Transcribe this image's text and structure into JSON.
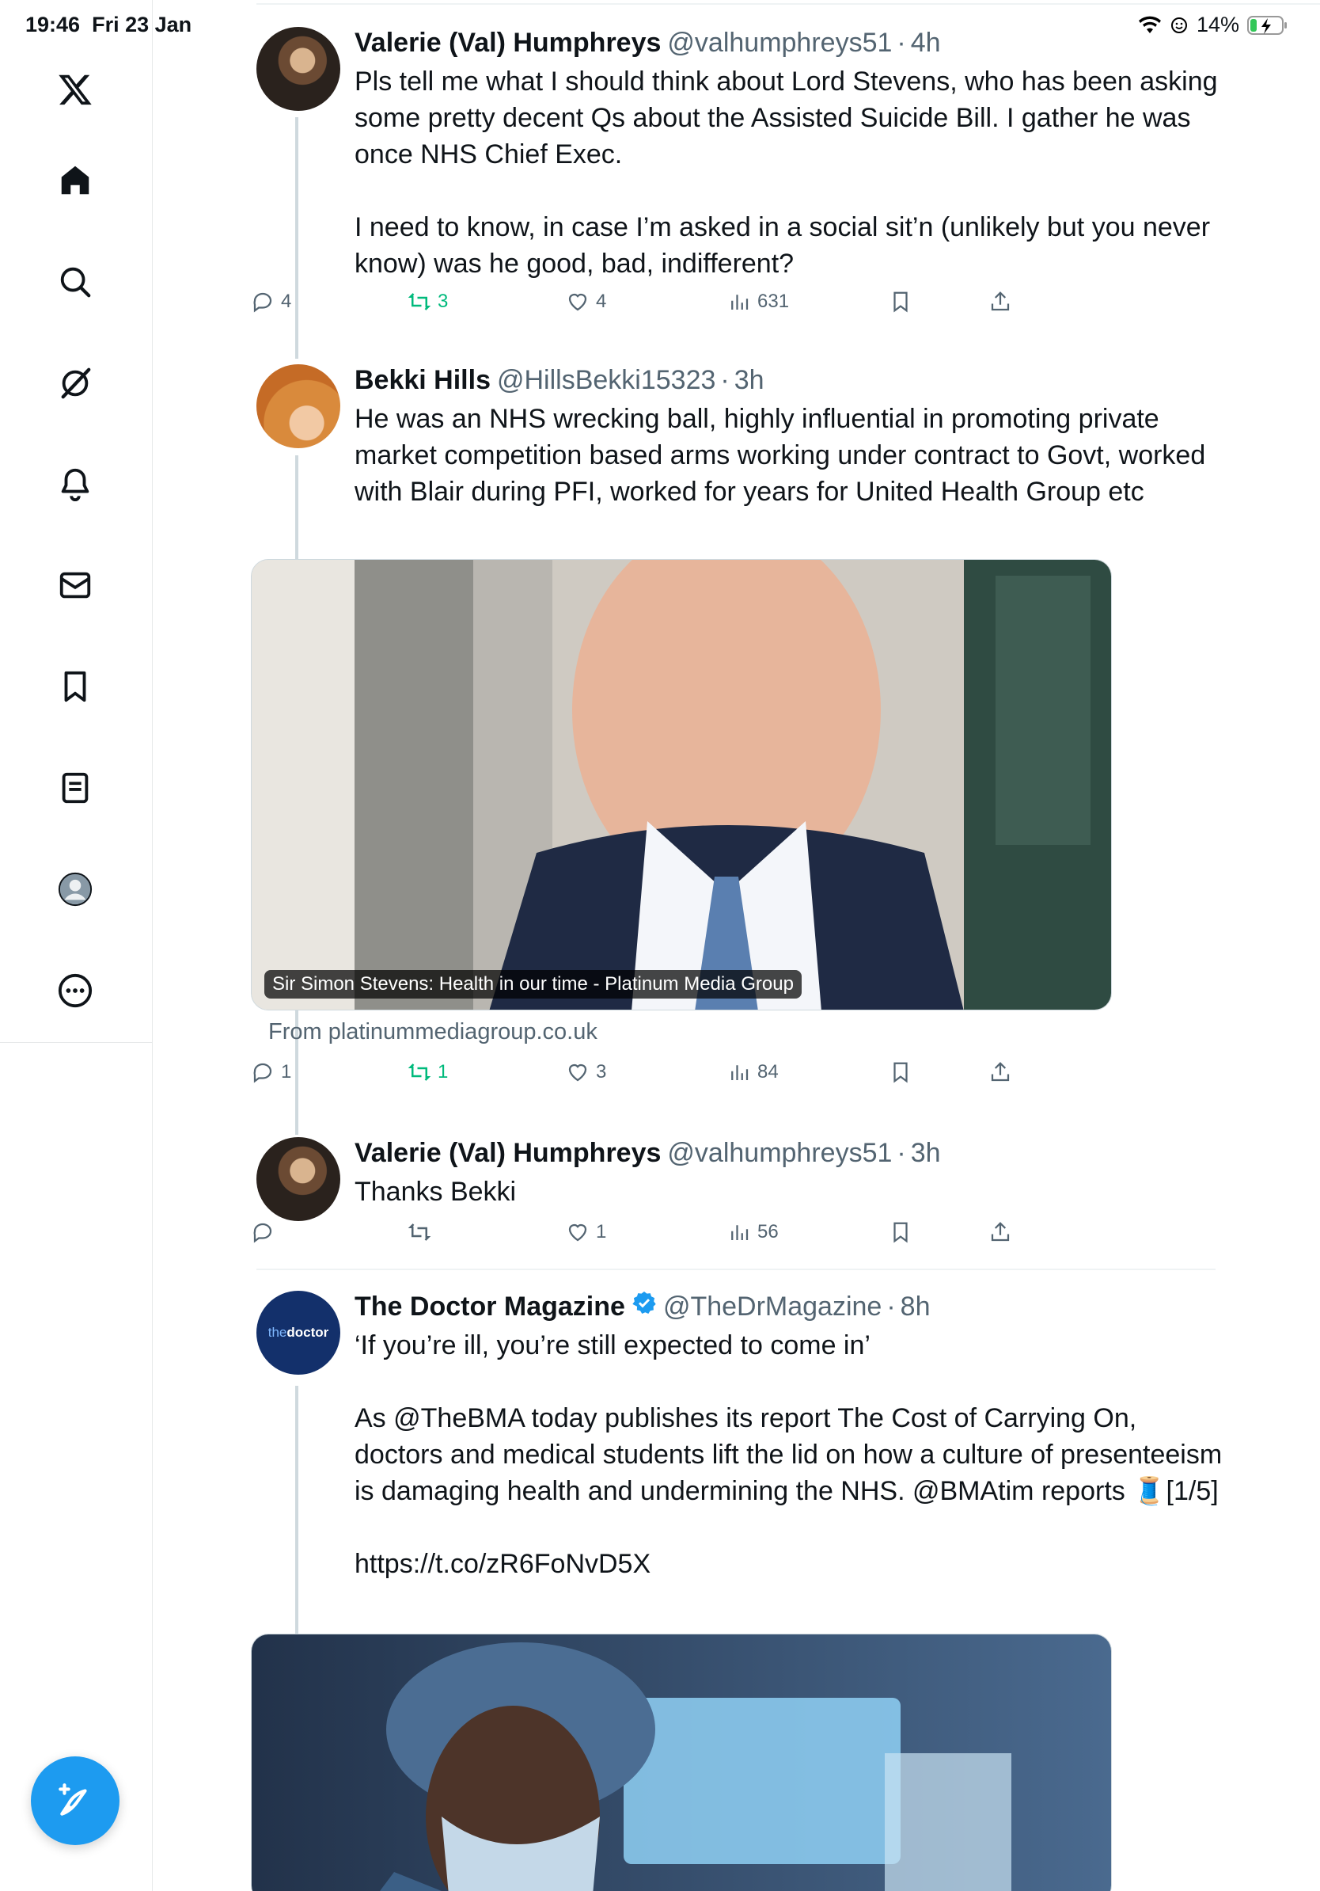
{
  "status_bar": {
    "time": "19:46",
    "date": "Fri 23 Jan",
    "battery": "14%"
  },
  "sidebar": {
    "items": [
      "home",
      "search",
      "grok",
      "notifications",
      "messages",
      "bookmarks",
      "lists",
      "profile",
      "more"
    ]
  },
  "tweets": [
    {
      "name": "Valerie (Val) Humphreys",
      "handle": "@valhumphreys51",
      "dot": "·",
      "time": "4h",
      "text": "Pls tell me what I should think about Lord Stevens, who has been asking some pretty decent Qs about the Assisted Suicide Bill. I gather he was once NHS Chief Exec.\n\nI need to know, in case I’m asked in a social sit’n (unlikely but you never know) was he good, bad, indifferent?",
      "replies": "4",
      "reposts": "3",
      "likes": "4",
      "views": "631"
    },
    {
      "name": "Bekki Hills",
      "handle": "@HillsBekki15323",
      "dot": "·",
      "time": "3h",
      "text": "He was an NHS wrecking ball, highly influential in promoting private market competition based arms working under contract to Govt, worked with Blair during PFI, worked for years for United Health Group etc",
      "card_caption": "Sir Simon Stevens: Health in our time - Platinum Media Group",
      "card_source": "From platinummediagroup.co.uk",
      "replies": "1",
      "reposts": "1",
      "likes": "3",
      "views": "84"
    },
    {
      "name": "Valerie (Val) Humphreys",
      "handle": "@valhumphreys51",
      "dot": "·",
      "time": "3h",
      "text": "Thanks Bekki",
      "replies": "",
      "reposts": "",
      "likes": "1",
      "views": "56"
    },
    {
      "name": "The Doctor Magazine",
      "handle": "@TheDrMagazine",
      "dot": "·",
      "time": "8h",
      "avatar_text_a": "the",
      "avatar_text_b": "doctor",
      "text": "‘If you’re ill, you’re still expected to come in’\n\nAs @TheBMA today publishes its report The Cost of Carrying On, doctors and medical students lift the lid on how a culture of presenteeism is damaging health and undermining the NHS. @BMAtim reports 🧵[1/5]\n\nhttps://t.co/zR6FoNvD5X"
    }
  ],
  "colors": {
    "accent": "#1d9bf0",
    "repost": "#00ba7c",
    "muted": "#536471"
  }
}
